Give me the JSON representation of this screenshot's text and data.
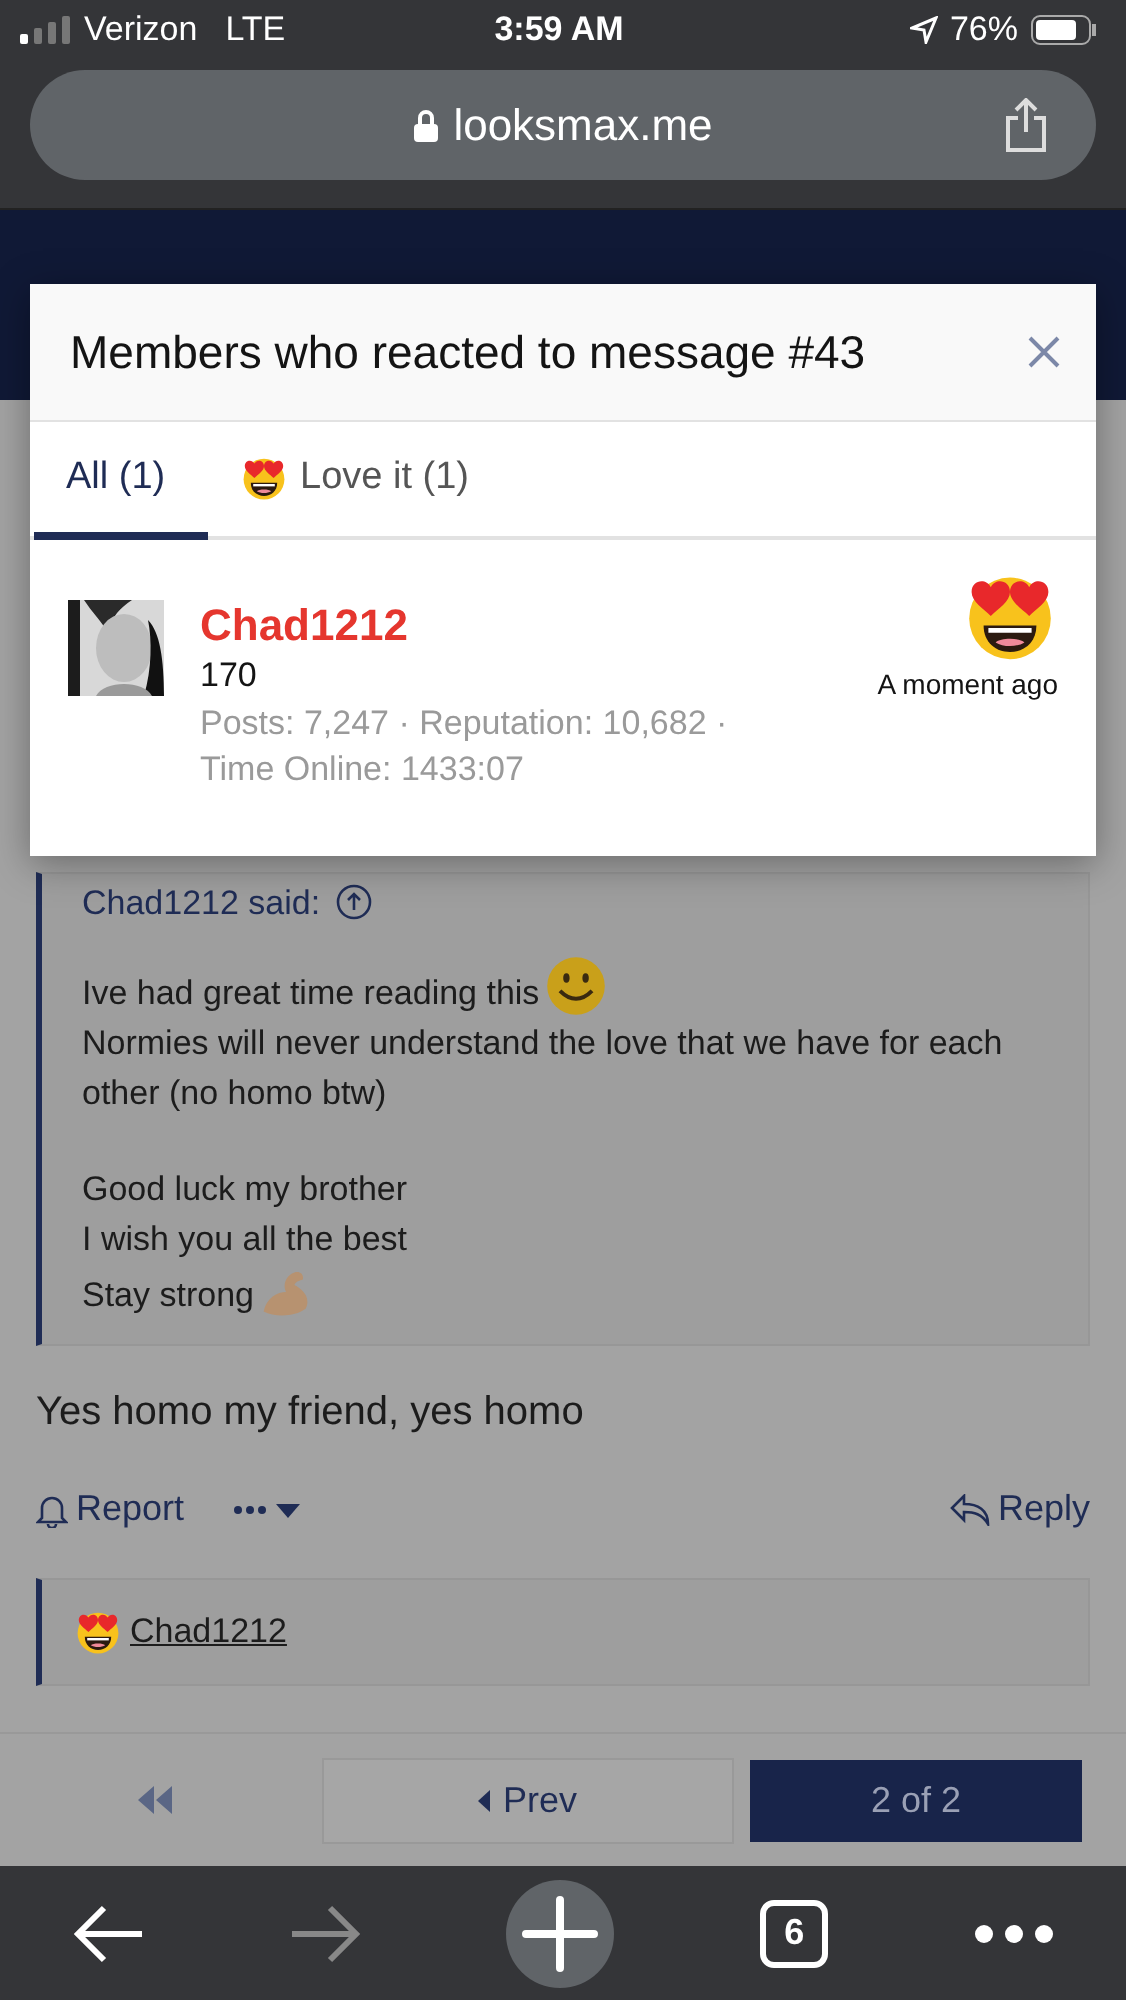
{
  "status_bar": {
    "carrier": "Verizon",
    "network": "LTE",
    "time": "3:59 AM",
    "battery": "76%"
  },
  "address_bar": {
    "url": "looksmax.me"
  },
  "post": {
    "quote": {
      "author": "Chad1212 said:",
      "paragraphs": [
        [
          {
            "text": "Ive had great time reading this",
            "kind": "smile"
          },
          {
            "text": "Normies will never understand the love that we have for each other (no homo btw)"
          }
        ],
        [
          {
            "text": "Good luck my brother"
          },
          {
            "text": "I wish you all the best"
          },
          {
            "text": "Stay strong",
            "kind": "muscle"
          }
        ]
      ]
    },
    "message": "Yes homo my friend, yes homo",
    "actions": [
      {
        "label": "Report",
        "kind": "report"
      },
      {
        "label": "Reply",
        "kind": "reply"
      }
    ],
    "reactions": [
      {
        "user": "Chad1212",
        "kind": "love"
      }
    ]
  },
  "pagination": {
    "prev": "Prev",
    "current": "2 of 2"
  },
  "toolbar": {
    "tab_count": "6"
  },
  "dialog": {
    "title": "Members who reacted to message #43",
    "tabs": [
      {
        "label": "All (1)",
        "selected": true
      },
      {
        "label": "Love it (1)",
        "selected": false,
        "kind": "love"
      }
    ],
    "members": [
      {
        "name": "Chad1212",
        "title": "170",
        "stats": "Posts: 7,247 · Reputation: 10,682 · Time Online: 1433:07",
        "time": "A moment ago",
        "kind": "love"
      }
    ]
  }
}
